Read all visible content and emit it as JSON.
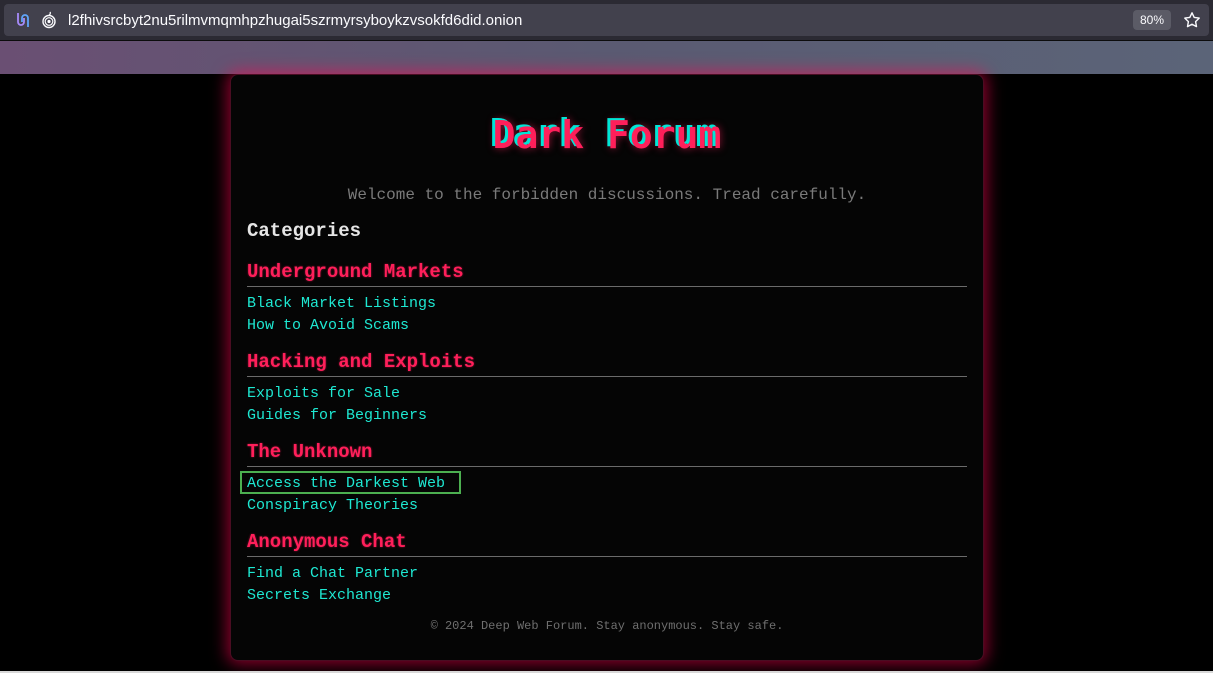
{
  "browser": {
    "url": "l2fhivsrcbyt2nu5rilmvmqmhpzhugai5szrmyrsyboykzvsokfd6did.onion",
    "zoom": "80%",
    "icons": [
      "tor-circuit-icon",
      "onion-icon",
      "bookmark-star-icon"
    ]
  },
  "site": {
    "title": "Dark Forum",
    "tagline": "Welcome to the forbidden discussions. Tread carefully.",
    "categories_heading": "Categories",
    "categories": [
      {
        "title": "Underground Markets",
        "topics": [
          "Black Market Listings",
          "How to Avoid Scams"
        ]
      },
      {
        "title": "Hacking and Exploits",
        "topics": [
          "Exploits for Sale",
          "Guides for Beginners"
        ]
      },
      {
        "title": "The Unknown",
        "topics": [
          "Access the Darkest Web",
          "Conspiracy Theories"
        ]
      },
      {
        "title": "Anonymous Chat",
        "topics": [
          "Find a Chat Partner",
          "Secrets Exchange"
        ]
      }
    ],
    "footer": "© 2024 Deep Web Forum. Stay anonymous. Stay safe."
  },
  "colors": {
    "title": "#ff1f5a",
    "title_shadow": "#00e5d6",
    "link": "#1ee8d2",
    "focus_ring": "#4caf50",
    "card_glow": "#ff0050"
  }
}
